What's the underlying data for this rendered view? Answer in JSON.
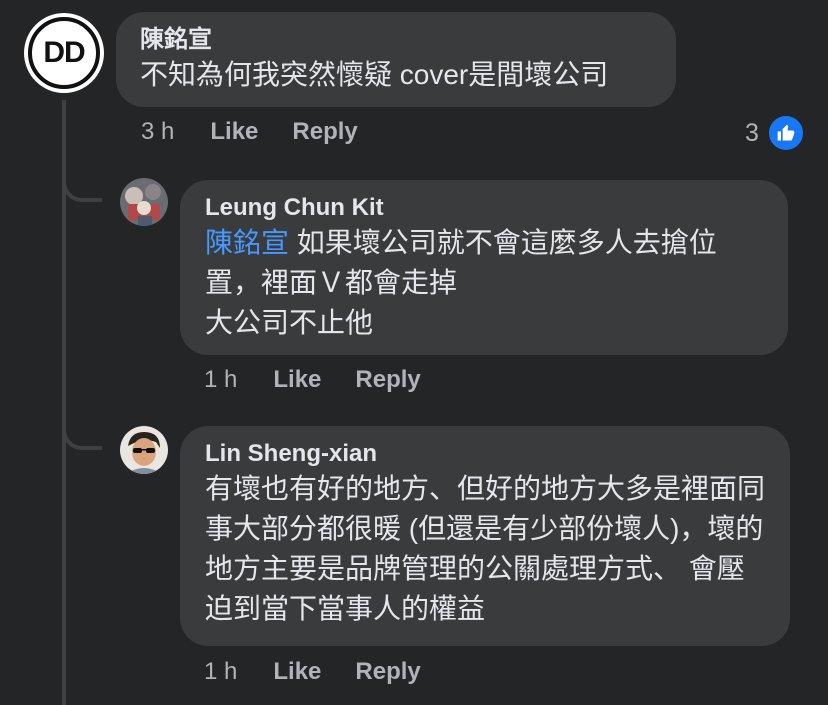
{
  "comments": [
    {
      "author": "陳銘宣",
      "avatar_text": "DD",
      "text": "不知為何我突然懷疑 cover是間壞公司",
      "time": "3 h",
      "like_label": "Like",
      "reply_label": "Reply",
      "reaction_count": "3",
      "reaction_icon": "thumbs-up-icon"
    },
    {
      "author": "Leung Chun Kit",
      "mention": "陳銘宣",
      "text": " 如果壞公司就不會這麼多人去搶位置，裡面Ｖ都會走掉\n大公司不止他",
      "time": "1 h",
      "like_label": "Like",
      "reply_label": "Reply"
    },
    {
      "author": "Lin Sheng-xian",
      "text": "有壞也有好的地方、但好的地方大多是裡面同事大部分都很暖 (但還是有少部份壞人)，壞的地方主要是品牌管理的公關處理方式、 會壓迫到當下當事人的權益",
      "time": "1 h",
      "like_label": "Like",
      "reply_label": "Reply"
    }
  ],
  "colors": {
    "background": "#242526",
    "bubble": "#3a3b3c",
    "mention": "#4599ff",
    "like_blue": "#1877f2"
  }
}
